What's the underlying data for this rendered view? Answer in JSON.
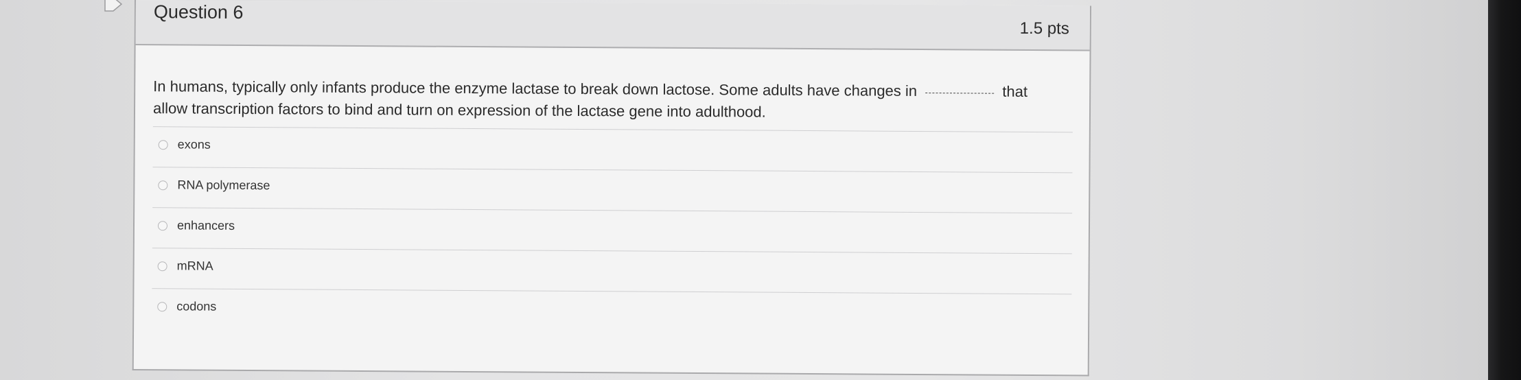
{
  "question": {
    "title": "Question 6",
    "points": "1.5 pts",
    "text_part1": "In humans, typically only infants produce the enzyme lactase to break down lactose. Some adults have changes in",
    "text_part2": "that",
    "text_part3": "allow transcription factors to bind and turn on expression of the lactase gene into adulthood.",
    "blank": "________"
  },
  "answers": [
    {
      "label": "exons"
    },
    {
      "label": "RNA polymerase"
    },
    {
      "label": "enhancers"
    },
    {
      "label": "mRNA"
    },
    {
      "label": "codons"
    }
  ],
  "icons": {
    "bookmark": "bookmark-icon",
    "radio": "radio-button"
  }
}
